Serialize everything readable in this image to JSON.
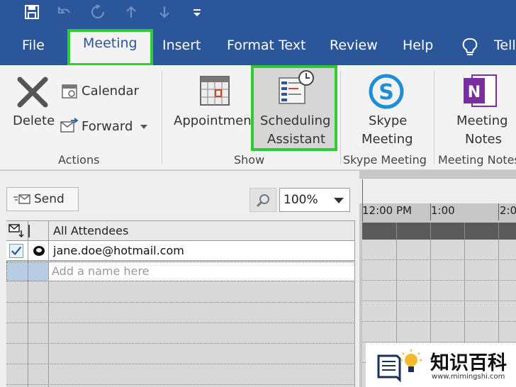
{
  "ribbon_tabs": {
    "file": "File",
    "meeting": "Meeting",
    "insert": "Insert",
    "format_text": "Format Text",
    "review": "Review",
    "help": "Help",
    "tell": "Tell"
  },
  "ribbon": {
    "actions": {
      "delete": "Delete",
      "calendar": "Calendar",
      "forward": "Forward",
      "label": "Actions"
    },
    "show": {
      "appointment": "Appointment",
      "scheduling_line1": "Scheduling",
      "scheduling_line2": "Assistant",
      "label": "Show"
    },
    "skype": {
      "line1": "Skype",
      "line2": "Meeting",
      "label": "Skype Meeting"
    },
    "notes": {
      "line1": "Meeting",
      "line2": "Notes",
      "label": "Meeting Notes"
    }
  },
  "scheduler": {
    "send_label": "Send",
    "zoom_value": "100%",
    "header_label": "All Attendees",
    "attendee": "jane.doe@hotmail.com",
    "add_placeholder": "Add a name here"
  },
  "timeline": {
    "times": [
      "12:00 PM",
      "1:00",
      "2:0"
    ]
  },
  "watermark": {
    "title": "知识百科",
    "url": "www.mimingshi.com"
  },
  "colors": {
    "ribbon_blue": "#2b579a",
    "highlight_green": "#2ecc2e",
    "onenote_purple": "#7b2f9e",
    "skype_blue": "#1e8fd5"
  }
}
